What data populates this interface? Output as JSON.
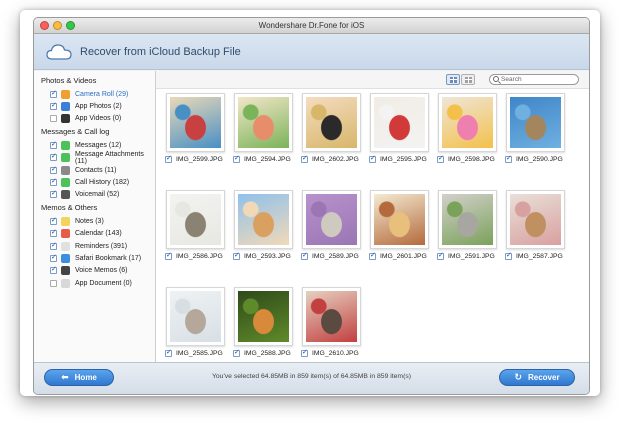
{
  "window": {
    "title": "Wondershare Dr.Fone for iOS"
  },
  "header": {
    "title": "Recover from iCloud Backup File"
  },
  "sidebar": {
    "sections": [
      {
        "title": "Photos & Videos",
        "items": [
          {
            "label": "Camera Roll (29)",
            "checked": true,
            "selected": true,
            "icon": "camera-roll-icon",
            "color": "#f0a030"
          },
          {
            "label": "App Photos (2)",
            "checked": true,
            "selected": false,
            "icon": "app-photos-icon",
            "color": "#3b7fd8"
          },
          {
            "label": "App Videos (0)",
            "checked": false,
            "selected": false,
            "icon": "app-videos-icon",
            "color": "#333333"
          }
        ]
      },
      {
        "title": "Messages & Call log",
        "items": [
          {
            "label": "Messages (12)",
            "checked": true,
            "selected": false,
            "icon": "messages-icon",
            "color": "#4cc35a"
          },
          {
            "label": "Message Attachments (11)",
            "checked": true,
            "selected": false,
            "icon": "attachments-icon",
            "color": "#4cc35a"
          },
          {
            "label": "Contacts (11)",
            "checked": true,
            "selected": false,
            "icon": "contacts-icon",
            "color": "#8a8a8a"
          },
          {
            "label": "Call History (182)",
            "checked": true,
            "selected": false,
            "icon": "phone-icon",
            "color": "#4cc35a"
          },
          {
            "label": "Voicemail (52)",
            "checked": true,
            "selected": false,
            "icon": "voicemail-icon",
            "color": "#555555"
          }
        ]
      },
      {
        "title": "Memos & Others",
        "items": [
          {
            "label": "Notes (3)",
            "checked": true,
            "selected": false,
            "icon": "notes-icon",
            "color": "#f2d35b"
          },
          {
            "label": "Calendar (143)",
            "checked": true,
            "selected": false,
            "icon": "calendar-icon",
            "color": "#e85b4b"
          },
          {
            "label": "Reminders (391)",
            "checked": true,
            "selected": false,
            "icon": "reminders-icon",
            "color": "#e0e0e0"
          },
          {
            "label": "Safari Bookmark (17)",
            "checked": true,
            "selected": false,
            "icon": "safari-icon",
            "color": "#3b8ee0"
          },
          {
            "label": "Voice Memos (6)",
            "checked": true,
            "selected": false,
            "icon": "voice-memos-icon",
            "color": "#444444"
          },
          {
            "label": "App Document (0)",
            "checked": false,
            "selected": false,
            "icon": "document-icon",
            "color": "#d8d8d8"
          }
        ]
      }
    ]
  },
  "toolbar": {
    "search_placeholder": "Search"
  },
  "photos": [
    {
      "name": "IMG_2599.JPG",
      "c1": "#e9d9b8",
      "c2": "#c94040",
      "c3": "#4a8fc4"
    },
    {
      "name": "IMG_2594.JPG",
      "c1": "#f2e6c8",
      "c2": "#e88d6a",
      "c3": "#7bb35a"
    },
    {
      "name": "IMG_2602.JPG",
      "c1": "#f4dcc0",
      "c2": "#2a2a2a",
      "c3": "#d8b66a"
    },
    {
      "name": "IMG_2595.JPG",
      "c1": "#f1ece4",
      "c2": "#d23a3a",
      "c3": "#f3f3f3"
    },
    {
      "name": "IMG_2598.JPG",
      "c1": "#efe6d8",
      "c2": "#ee7faf",
      "c3": "#f3c04a"
    },
    {
      "name": "IMG_2590.JPG",
      "c1": "#3f86c8",
      "c2": "#a4865e",
      "c3": "#6fb0e0"
    },
    {
      "name": "IMG_2586.JPG",
      "c1": "#f3f3f1",
      "c2": "#8a8272",
      "c3": "#e7e7e2"
    },
    {
      "name": "IMG_2593.JPG",
      "c1": "#8fc1ec",
      "c2": "#d9a060",
      "c3": "#f1d9b8"
    },
    {
      "name": "IMG_2589.JPG",
      "c1": "#b792cc",
      "c2": "#cfcac0",
      "c3": "#9a76b4"
    },
    {
      "name": "IMG_2601.JPG",
      "c1": "#f4ead2",
      "c2": "#e8c07c",
      "c3": "#b46a3c"
    },
    {
      "name": "IMG_2591.JPG",
      "c1": "#d2d0cb",
      "c2": "#a8a6a0",
      "c3": "#7ba25a"
    },
    {
      "name": "IMG_2587.JPG",
      "c1": "#e9e0d8",
      "c2": "#c09060",
      "c3": "#d8a0a0"
    },
    {
      "name": "IMG_2585.JPG",
      "c1": "#eef2f4",
      "c2": "#b5a89a",
      "c3": "#d8dfe4"
    },
    {
      "name": "IMG_2588.JPG",
      "c1": "#2f4a1a",
      "c2": "#d88a3a",
      "c3": "#5f8a2a"
    },
    {
      "name": "IMG_2610.JPG",
      "c1": "#e6d0c0",
      "c2": "#5a4a40",
      "c3": "#c24040"
    }
  ],
  "footer": {
    "home_label": "Home",
    "recover_label": "Recover",
    "status": "You've selected 64.85MB in 859 item(s) of 64.85MB in 859 item(s)"
  }
}
